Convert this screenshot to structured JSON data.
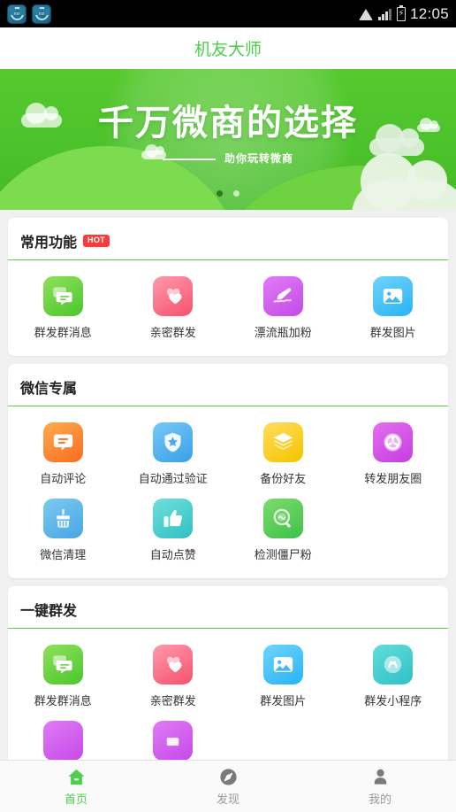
{
  "status_bar": {
    "time": "12:05",
    "left_icons": [
      "app-icon-1",
      "app-icon-2"
    ],
    "right_icons": [
      "wifi-icon",
      "signal-icon",
      "battery-charging-icon"
    ],
    "battery_glyph": "⚡"
  },
  "app_bar": {
    "title": "机友大师",
    "title_color": "#4cd04c"
  },
  "banner": {
    "headline": "千万微商的选择",
    "subline": "助你玩转微商",
    "dots": 2,
    "active_dot": 0,
    "bg_color": "#4cc22b"
  },
  "sections": [
    {
      "title": "常用功能",
      "badge": "HOT",
      "badge_color": "#fb3b3b",
      "items": [
        {
          "label": "群发群消息",
          "icon": "chat-bubbles-icon",
          "style": "g-green"
        },
        {
          "label": "亲密群发",
          "icon": "hearts-icon",
          "style": "g-pink"
        },
        {
          "label": "漂流瓶加粉",
          "icon": "drift-bottle-icon",
          "style": "g-purple"
        },
        {
          "label": "群发图片",
          "icon": "photo-icon",
          "style": "g-blue"
        }
      ]
    },
    {
      "title": "微信专属",
      "badge": "",
      "items": [
        {
          "label": "自动评论",
          "icon": "comment-icon",
          "style": "g-orange"
        },
        {
          "label": "自动通过验证",
          "icon": "shield-star-icon",
          "style": "g-blue2"
        },
        {
          "label": "备份好友",
          "icon": "layers-icon",
          "style": "g-yellow"
        },
        {
          "label": "转发朋友圈",
          "icon": "aperture-icon",
          "style": "g-magenta"
        },
        {
          "label": "微信清理",
          "icon": "broom-icon",
          "style": "g-blue3"
        },
        {
          "label": "自动点赞",
          "icon": "thumbs-up-icon",
          "style": "g-teal"
        },
        {
          "label": "检测僵尸粉",
          "icon": "search-zombie-icon",
          "style": "g-green2"
        }
      ]
    },
    {
      "title": "一键群发",
      "badge": "",
      "items": [
        {
          "label": "群发群消息",
          "icon": "chat-bubbles-icon",
          "style": "g-green"
        },
        {
          "label": "亲密群发",
          "icon": "hearts-icon",
          "style": "g-pink"
        },
        {
          "label": "群发图片",
          "icon": "photo-icon",
          "style": "g-blue"
        },
        {
          "label": "群发小程序",
          "icon": "mini-program-icon",
          "style": "g-teal2"
        },
        {
          "label": "",
          "icon": "partial-icon-1",
          "style": "g-purple"
        },
        {
          "label": "",
          "icon": "partial-icon-2",
          "style": "g-purple"
        }
      ]
    }
  ],
  "tabbar": {
    "items": [
      {
        "label": "首页",
        "icon": "home-icon",
        "active": true
      },
      {
        "label": "发现",
        "icon": "compass-icon",
        "active": false
      },
      {
        "label": "我的",
        "icon": "person-icon",
        "active": false
      }
    ],
    "active_color": "#4cd04c",
    "inactive_color": "#9a9a9a"
  }
}
